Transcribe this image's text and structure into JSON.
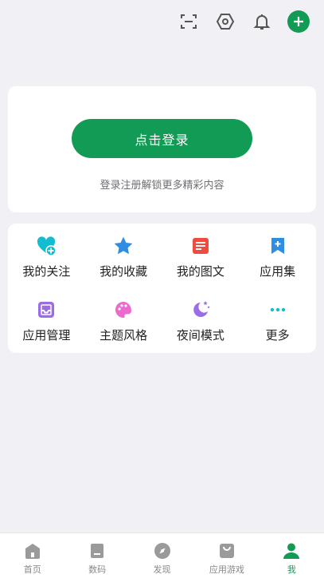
{
  "colors": {
    "accent": "#129b55",
    "icon_gray": "#555555",
    "nav_gray": "#9a9a9a",
    "follow": "#12bcd1",
    "favorites": "#2f8de4",
    "graphics": "#ef4b3f",
    "collection": "#2f8de4",
    "app_manage": "#9b6ce8",
    "theme": "#ea6ad0",
    "night": "#9b6ce8",
    "more": "#12bcd1"
  },
  "topbar": {
    "icons": [
      "scan-icon",
      "settings-icon",
      "notification-bell-icon",
      "add-icon"
    ]
  },
  "login": {
    "button_label": "点击登录",
    "hint": "登录注册解锁更多精彩内容"
  },
  "shortcuts": [
    {
      "label": "我的关注",
      "icon": "heart-plus-icon"
    },
    {
      "label": "我的收藏",
      "icon": "star-icon"
    },
    {
      "label": "我的图文",
      "icon": "document-icon"
    },
    {
      "label": "应用集",
      "icon": "bookmark-plus-icon"
    },
    {
      "label": "应用管理",
      "icon": "inbox-icon"
    },
    {
      "label": "主题风格",
      "icon": "palette-icon"
    },
    {
      "label": "夜间模式",
      "icon": "moon-icon"
    },
    {
      "label": "更多",
      "icon": "more-dots-icon"
    }
  ],
  "bottom_nav": [
    {
      "label": "首页",
      "icon": "home-icon",
      "active": false
    },
    {
      "label": "数码",
      "icon": "device-icon",
      "active": false
    },
    {
      "label": "发现",
      "icon": "compass-icon",
      "active": false
    },
    {
      "label": "应用游戏",
      "icon": "bag-icon",
      "active": false
    },
    {
      "label": "我",
      "icon": "profile-icon",
      "active": true
    }
  ]
}
